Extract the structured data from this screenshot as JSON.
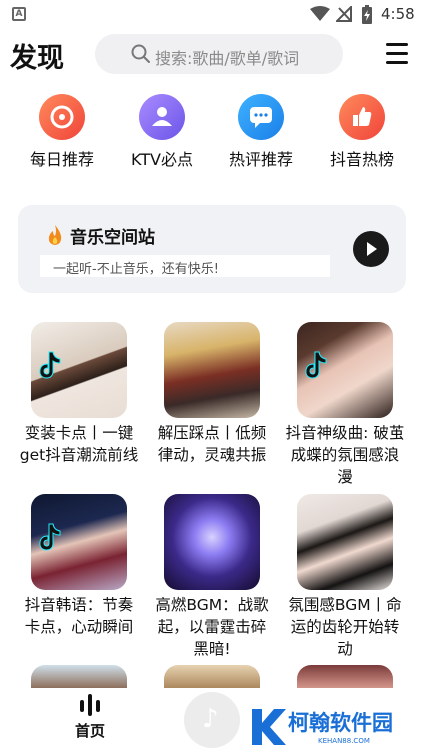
{
  "status_bar": {
    "app_letter": "A",
    "time": "4:58"
  },
  "header": {
    "title": "发现",
    "search_placeholder": "搜索:歌曲/歌单/歌词"
  },
  "quick_entries": [
    {
      "label": "每日推荐",
      "icon": "disc-icon",
      "color": "#f3573f"
    },
    {
      "label": "KTV必点",
      "icon": "user-icon",
      "color": "#8a6bf0"
    },
    {
      "label": "热评推荐",
      "icon": "chat-icon",
      "color": "#1e90f0"
    },
    {
      "label": "抖音热榜",
      "icon": "thumbs-up-icon",
      "color": "#f3573f"
    }
  ],
  "space_card": {
    "title": "音乐空间站",
    "subtitle": "一起听-不止音乐，还有快乐!"
  },
  "playlists": [
    {
      "title": "变装卡点丨一键get抖音潮流前线",
      "tiktok": true
    },
    {
      "title": "解压踩点丨低频律动，灵魂共振",
      "tiktok": false
    },
    {
      "title": "抖音神级曲: 破茧成蝶的氛围感浪漫",
      "tiktok": true
    },
    {
      "title": "抖音韩语：节奏卡点，心动瞬间",
      "tiktok": true
    },
    {
      "title": "高燃BGM：战歌起，以雷霆击碎黑暗!",
      "tiktok": false
    },
    {
      "title": "氛围感BGM丨命运的齿轮开始转动",
      "tiktok": false
    }
  ],
  "bottom_nav": {
    "home_label": "首页"
  },
  "watermark": {
    "text": "柯翰软件园",
    "url": "KEHAN88.COM"
  }
}
